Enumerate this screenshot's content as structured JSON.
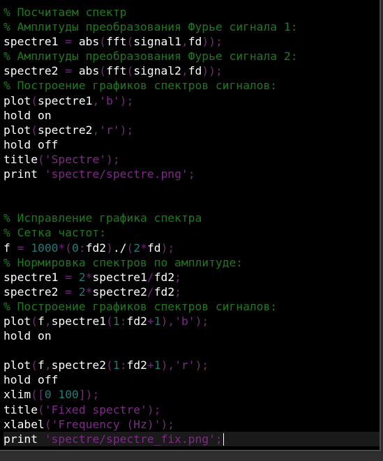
{
  "editor": {
    "lines": [
      [
        {
          "t": "% Посчитаем спектр",
          "k": "c"
        }
      ],
      [
        {
          "t": "% Амплитуды преобразования Фурье сигнала 1:",
          "k": "c"
        }
      ],
      [
        {
          "t": "spectre1 "
        },
        {
          "t": "=",
          "k": "op"
        },
        {
          "t": " abs"
        },
        {
          "t": "(",
          "k": "p"
        },
        {
          "t": "fft"
        },
        {
          "t": "(",
          "k": "p"
        },
        {
          "t": "signal1"
        },
        {
          "t": ",",
          "k": "p"
        },
        {
          "t": "fd"
        },
        {
          "t": "));",
          "k": "p"
        }
      ],
      [
        {
          "t": "% Амплитуды преобразования Фурье сигнала 2:",
          "k": "c"
        }
      ],
      [
        {
          "t": "spectre2 "
        },
        {
          "t": "=",
          "k": "op"
        },
        {
          "t": " abs"
        },
        {
          "t": "(",
          "k": "p"
        },
        {
          "t": "fft"
        },
        {
          "t": "(",
          "k": "p"
        },
        {
          "t": "signal2"
        },
        {
          "t": ",",
          "k": "p"
        },
        {
          "t": "fd"
        },
        {
          "t": "));",
          "k": "p"
        }
      ],
      [
        {
          "t": "% Построение графиков спектров сигналов:",
          "k": "c"
        }
      ],
      [
        {
          "t": "plot"
        },
        {
          "t": "(",
          "k": "p"
        },
        {
          "t": "spectre1"
        },
        {
          "t": ",",
          "k": "p"
        },
        {
          "t": "'b'",
          "k": "s"
        },
        {
          "t": ");",
          "k": "p"
        }
      ],
      [
        {
          "t": "hold on"
        }
      ],
      [
        {
          "t": "plot"
        },
        {
          "t": "(",
          "k": "p"
        },
        {
          "t": "spectre2"
        },
        {
          "t": ",",
          "k": "p"
        },
        {
          "t": "'r'",
          "k": "s"
        },
        {
          "t": ");",
          "k": "p"
        }
      ],
      [
        {
          "t": "hold off"
        }
      ],
      [
        {
          "t": "title"
        },
        {
          "t": "(",
          "k": "p"
        },
        {
          "t": "'Spectre'",
          "k": "s"
        },
        {
          "t": ");",
          "k": "p"
        }
      ],
      [
        {
          "t": "print "
        },
        {
          "t": "'spectre/spectre.png'",
          "k": "s"
        },
        {
          "t": ";",
          "k": "p"
        }
      ],
      [],
      [],
      [
        {
          "t": "% Исправление графика спектра",
          "k": "c"
        }
      ],
      [
        {
          "t": "% Сетка частот:",
          "k": "c"
        }
      ],
      [
        {
          "t": "f "
        },
        {
          "t": "=",
          "k": "op"
        },
        {
          "t": " "
        },
        {
          "t": "1000",
          "k": "n"
        },
        {
          "t": "*",
          "k": "op"
        },
        {
          "t": "(",
          "k": "p"
        },
        {
          "t": "0",
          "k": "n"
        },
        {
          "t": ":",
          "k": "p"
        },
        {
          "t": "fd2"
        },
        {
          "t": ")",
          "k": "p"
        },
        {
          "t": "./"
        },
        {
          "t": "(",
          "k": "p"
        },
        {
          "t": "2",
          "k": "n"
        },
        {
          "t": "*",
          "k": "op"
        },
        {
          "t": "fd"
        },
        {
          "t": ");",
          "k": "p"
        }
      ],
      [
        {
          "t": "% Нормировка спектров по амплитуде:",
          "k": "c"
        }
      ],
      [
        {
          "t": "spectre1 "
        },
        {
          "t": "=",
          "k": "op"
        },
        {
          "t": " "
        },
        {
          "t": "2",
          "k": "n"
        },
        {
          "t": "*",
          "k": "op"
        },
        {
          "t": "spectre1"
        },
        {
          "t": "/",
          "k": "op"
        },
        {
          "t": "fd2"
        },
        {
          "t": ";",
          "k": "p"
        }
      ],
      [
        {
          "t": "spectre2 "
        },
        {
          "t": "=",
          "k": "op"
        },
        {
          "t": " "
        },
        {
          "t": "2",
          "k": "n"
        },
        {
          "t": "*",
          "k": "op"
        },
        {
          "t": "spectre2"
        },
        {
          "t": "/",
          "k": "op"
        },
        {
          "t": "fd2"
        },
        {
          "t": ";",
          "k": "p"
        }
      ],
      [
        {
          "t": "% Построение графиков спектров сигналов:",
          "k": "c"
        }
      ],
      [
        {
          "t": "plot"
        },
        {
          "t": "(",
          "k": "p"
        },
        {
          "t": "f"
        },
        {
          "t": ",",
          "k": "p"
        },
        {
          "t": "spectre1"
        },
        {
          "t": "(",
          "k": "p"
        },
        {
          "t": "1",
          "k": "n"
        },
        {
          "t": ":",
          "k": "p"
        },
        {
          "t": "fd2"
        },
        {
          "t": "+",
          "k": "op"
        },
        {
          "t": "1",
          "k": "n"
        },
        {
          "t": ")",
          "k": "p"
        },
        {
          "t": ",",
          "k": "p"
        },
        {
          "t": "'b'",
          "k": "s"
        },
        {
          "t": ");",
          "k": "p"
        }
      ],
      [
        {
          "t": "hold on"
        }
      ],
      [],
      [
        {
          "t": "plot"
        },
        {
          "t": "(",
          "k": "p"
        },
        {
          "t": "f"
        },
        {
          "t": ",",
          "k": "p"
        },
        {
          "t": "spectre2"
        },
        {
          "t": "(",
          "k": "p"
        },
        {
          "t": "1",
          "k": "n"
        },
        {
          "t": ":",
          "k": "p"
        },
        {
          "t": "fd2"
        },
        {
          "t": "+",
          "k": "op"
        },
        {
          "t": "1",
          "k": "n"
        },
        {
          "t": ")",
          "k": "p"
        },
        {
          "t": ",",
          "k": "p"
        },
        {
          "t": "'r'",
          "k": "s"
        },
        {
          "t": ");",
          "k": "p"
        }
      ],
      [
        {
          "t": "hold off"
        }
      ],
      [
        {
          "t": "xlim"
        },
        {
          "t": "([",
          "k": "p"
        },
        {
          "t": "0 100",
          "k": "n"
        },
        {
          "t": "]);",
          "k": "p"
        }
      ],
      [
        {
          "t": "title"
        },
        {
          "t": "(",
          "k": "p"
        },
        {
          "t": "'Fixed spectre'",
          "k": "s"
        },
        {
          "t": ");",
          "k": "p"
        }
      ],
      [
        {
          "t": "xlabel"
        },
        {
          "t": "(",
          "k": "p"
        },
        {
          "t": "'Frequency (Hz)'",
          "k": "s"
        },
        {
          "t": ");",
          "k": "p"
        }
      ],
      [
        {
          "t": "print "
        },
        {
          "t": "'spectre/spectre_fix.png'",
          "k": "s"
        },
        {
          "t": ";",
          "k": "p"
        }
      ]
    ],
    "current_line": 29
  },
  "colors": {
    "background": "#000000",
    "text": "#ffffff",
    "comment": "#1f7a1f",
    "string": "#7f2a8a",
    "number": "#1f7a7a",
    "operator": "#7a1f8a",
    "punctuation": "#6f2f6f"
  }
}
